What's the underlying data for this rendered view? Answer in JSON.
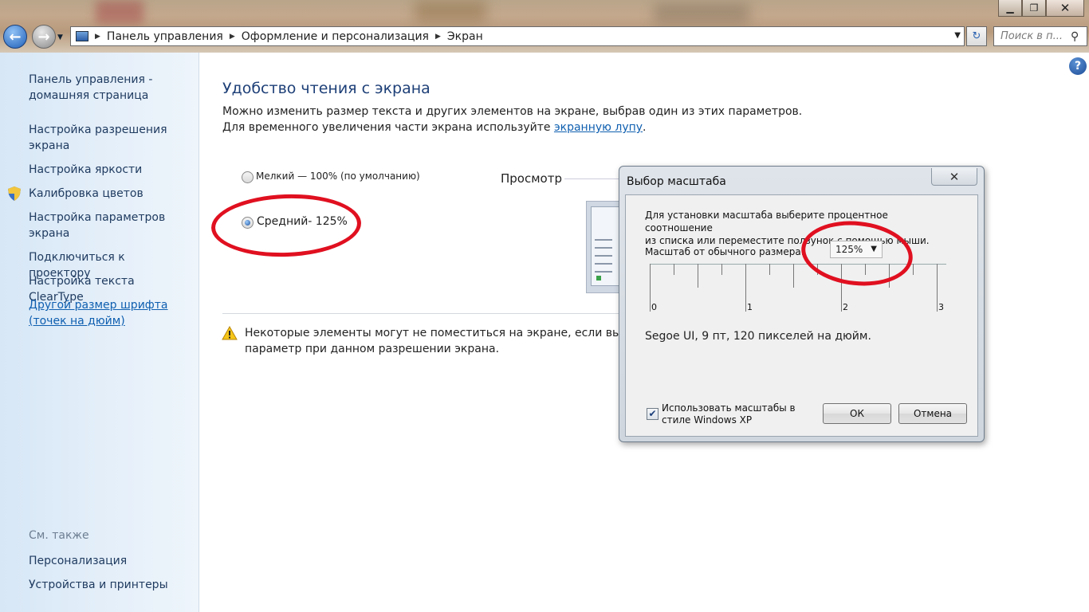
{
  "window": {
    "minimize_glyph": "▁",
    "maximize_glyph": "❐",
    "close_glyph": "✕"
  },
  "nav": {
    "back_glyph": "←",
    "forward_glyph": "→",
    "history_glyph": "▼"
  },
  "address": {
    "breadcrumbs": [
      "Панель управления",
      "Оформление и персонализация",
      "Экран"
    ],
    "separator": "▶",
    "dropdown_glyph": "▼",
    "refresh_glyph": "↻"
  },
  "search": {
    "placeholder": "Поиск в п...",
    "icon_glyph": "⚲"
  },
  "sidebar": {
    "items": [
      {
        "label": "Панель управления - домашняя страница"
      },
      {
        "label": "Настройка разрешения экрана"
      },
      {
        "label": "Настройка яркости"
      },
      {
        "label": "Калибровка цветов"
      },
      {
        "label": "Настройка параметров экрана"
      },
      {
        "label": "Подключиться к проектору"
      },
      {
        "label": "Настройка текста ClearType"
      },
      {
        "label": "Другой размер шрифта (точек на дюйм)"
      }
    ],
    "see_also_heading": "См. также",
    "see_also": [
      {
        "label": "Персонализация"
      },
      {
        "label": "Устройства и принтеры"
      }
    ]
  },
  "main": {
    "help_glyph": "?",
    "title": "Удобство чтения с экрана",
    "description": "Можно изменить размер текста и других элементов на экране, выбрав один из этих параметров. Для временного увеличения части экрана используйте ",
    "magnifier_link": "экранную лупу",
    "description_end": ".",
    "options": [
      {
        "label": "Мелкий — 100% (по умолчанию)",
        "selected": false
      },
      {
        "label": "Средний- 125%",
        "selected": true
      }
    ],
    "preview_label": "Просмотр",
    "warning_line1": "Некоторые элементы могут не поместиться на экране, если выбрать",
    "warning_line2": "параметр при данном разрешении экрана."
  },
  "dialog": {
    "title": "Выбор масштаба",
    "close_glyph": "✕",
    "instruction_line1": "Для установки масштаба выберите процентное соотношение",
    "instruction_line2": "из списка или переместите ползунок с помощью мыши.",
    "scale_label": "Масштаб от обычного размера:",
    "scale_value": "125%",
    "scale_arrow": "▼",
    "ruler_numbers": [
      "0",
      "1",
      "2",
      "3"
    ],
    "font_info": "Segoe UI, 9 пт, 120 пикселей на дюйм.",
    "checkbox_checked": true,
    "checkbox_glyph": "✔",
    "checkbox_label": "Использовать масштабы в стиле Windows XP",
    "ok_label": "ОК",
    "cancel_label": "Отмена"
  },
  "colors": {
    "annotation_red": "#e01020",
    "link_blue": "#0f5fb0",
    "title_blue": "#1d3f77"
  }
}
